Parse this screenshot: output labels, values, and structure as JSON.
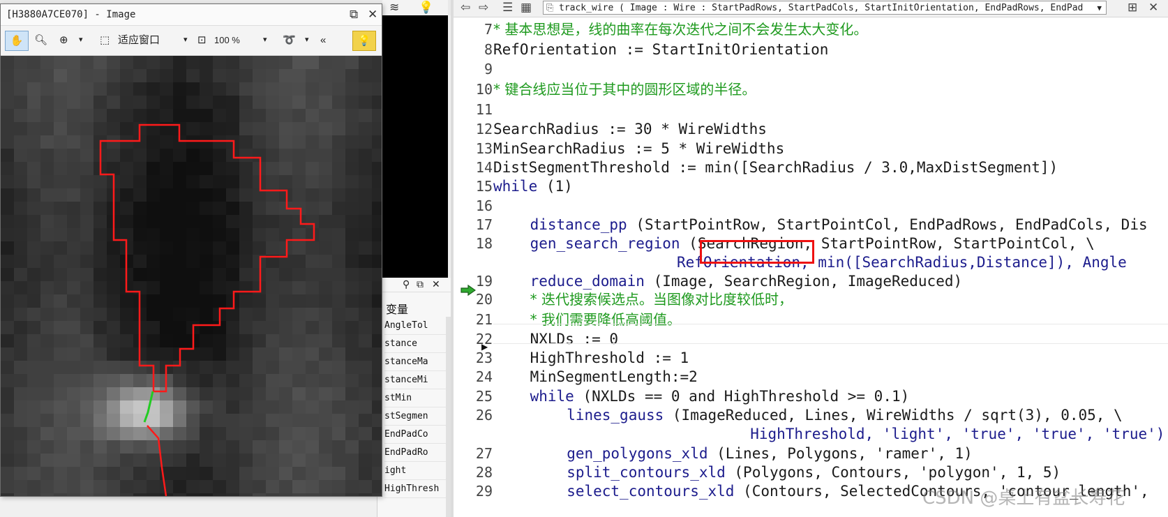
{
  "image_window": {
    "title": "[H3880A7CE070] - Image",
    "tools": {
      "fit_label": "适应窗口",
      "zoom_value": "100 %"
    }
  },
  "variables_panel": {
    "title": "变量",
    "items": [
      "AngleTol",
      "stance",
      "stanceMa",
      "stanceMi",
      "stMin",
      "stSegmen",
      "EndPadCo",
      "EndPadRo",
      "ight",
      "HighThresh"
    ]
  },
  "editor": {
    "procedure_signature": "track_wire ( Image : Wire : StartPadRows, StartPadCols, StartInitOrientation, EndPadRows, EndPad",
    "lines": [
      {
        "n": "7",
        "cls": "cmt",
        "indent": 0,
        "text": "* 基本思想是，线的曲率在每次迭代之间不会发生太大变化。"
      },
      {
        "n": "8",
        "cls": "",
        "indent": 0,
        "text": "RefOrientation := StartInitOrientation"
      },
      {
        "n": "9",
        "cls": "",
        "indent": 0,
        "text": ""
      },
      {
        "n": "10",
        "cls": "cmt",
        "indent": 0,
        "text": "* 键合线应当位于其中的圆形区域的半径。"
      },
      {
        "n": "11",
        "cls": "",
        "indent": 0,
        "text": ""
      },
      {
        "n": "12",
        "cls": "",
        "indent": 0,
        "text": "SearchRadius := 30 * WireWidths"
      },
      {
        "n": "13",
        "cls": "",
        "indent": 0,
        "text": "MinSearchRadius := 5 * WireWidths"
      },
      {
        "n": "14",
        "cls": "",
        "indent": 0,
        "text": "DistSegmentThreshold := min([SearchRadius / 3.0,MaxDistSegment])"
      },
      {
        "n": "15",
        "cls": "kw",
        "indent": 0,
        "text": "while (1)"
      },
      {
        "n": "16",
        "cls": "",
        "indent": 0,
        "text": ""
      },
      {
        "n": "17",
        "cls": "kw",
        "indent": 1,
        "text": "distance_pp (StartPointRow, StartPointCol, EndPadRows, EndPadCols, Dis"
      },
      {
        "n": "18",
        "cls": "kw",
        "indent": 1,
        "text": "gen_search_region (SearchRegion, StartPointRow, StartPointCol, \\"
      },
      {
        "n": "",
        "cls": "kw",
        "indent": 5,
        "text": "RefOrientation, min([SearchRadius,Distance]), Angle"
      },
      {
        "n": "19",
        "cls": "kw",
        "indent": 1,
        "text": "reduce_domain (Image, SearchRegion, ImageReduced)"
      },
      {
        "n": "20",
        "cls": "cmt",
        "indent": 1,
        "text": "* 迭代搜索候选点。当图像对比度较低时，"
      },
      {
        "n": "21",
        "cls": "cmt",
        "indent": 1,
        "text": "* 我们需要降低高阈值。"
      },
      {
        "n": "22",
        "cls": "",
        "indent": 1,
        "text": "NXLDs := 0"
      },
      {
        "n": "23",
        "cls": "",
        "indent": 1,
        "text": "HighThreshold := 1"
      },
      {
        "n": "24",
        "cls": "",
        "indent": 1,
        "text": "MinSegmentLength:=2"
      },
      {
        "n": "25",
        "cls": "kw",
        "indent": 1,
        "text": "while (NXLDs == 0 and HighThreshold >= 0.1)"
      },
      {
        "n": "26",
        "cls": "kw",
        "indent": 2,
        "text": "lines_gauss (ImageReduced, Lines, WireWidths / sqrt(3), 0.05, \\"
      },
      {
        "n": "",
        "cls": "kw",
        "indent": 7,
        "text": "HighThreshold, 'light', 'true', 'true', 'true')"
      },
      {
        "n": "27",
        "cls": "kw",
        "indent": 2,
        "text": "gen_polygons_xld (Lines, Polygons, 'ramer', 1)"
      },
      {
        "n": "28",
        "cls": "kw",
        "indent": 2,
        "text": "split_contours_xld (Polygons, Contours, 'polygon', 1, 5)"
      },
      {
        "n": "29",
        "cls": "kw",
        "indent": 2,
        "text": "select_contours_xld (Contours, SelectedContours, 'contour_length',"
      }
    ],
    "watermark": "CSDN @桌上有盆长寿花"
  },
  "colors": {
    "comment": "#1f9a1f",
    "operator": "#1c1c8c",
    "highlight_box": "#e11111",
    "region_outline": "#ff1a1a",
    "wire_segment": "#22cc22"
  }
}
